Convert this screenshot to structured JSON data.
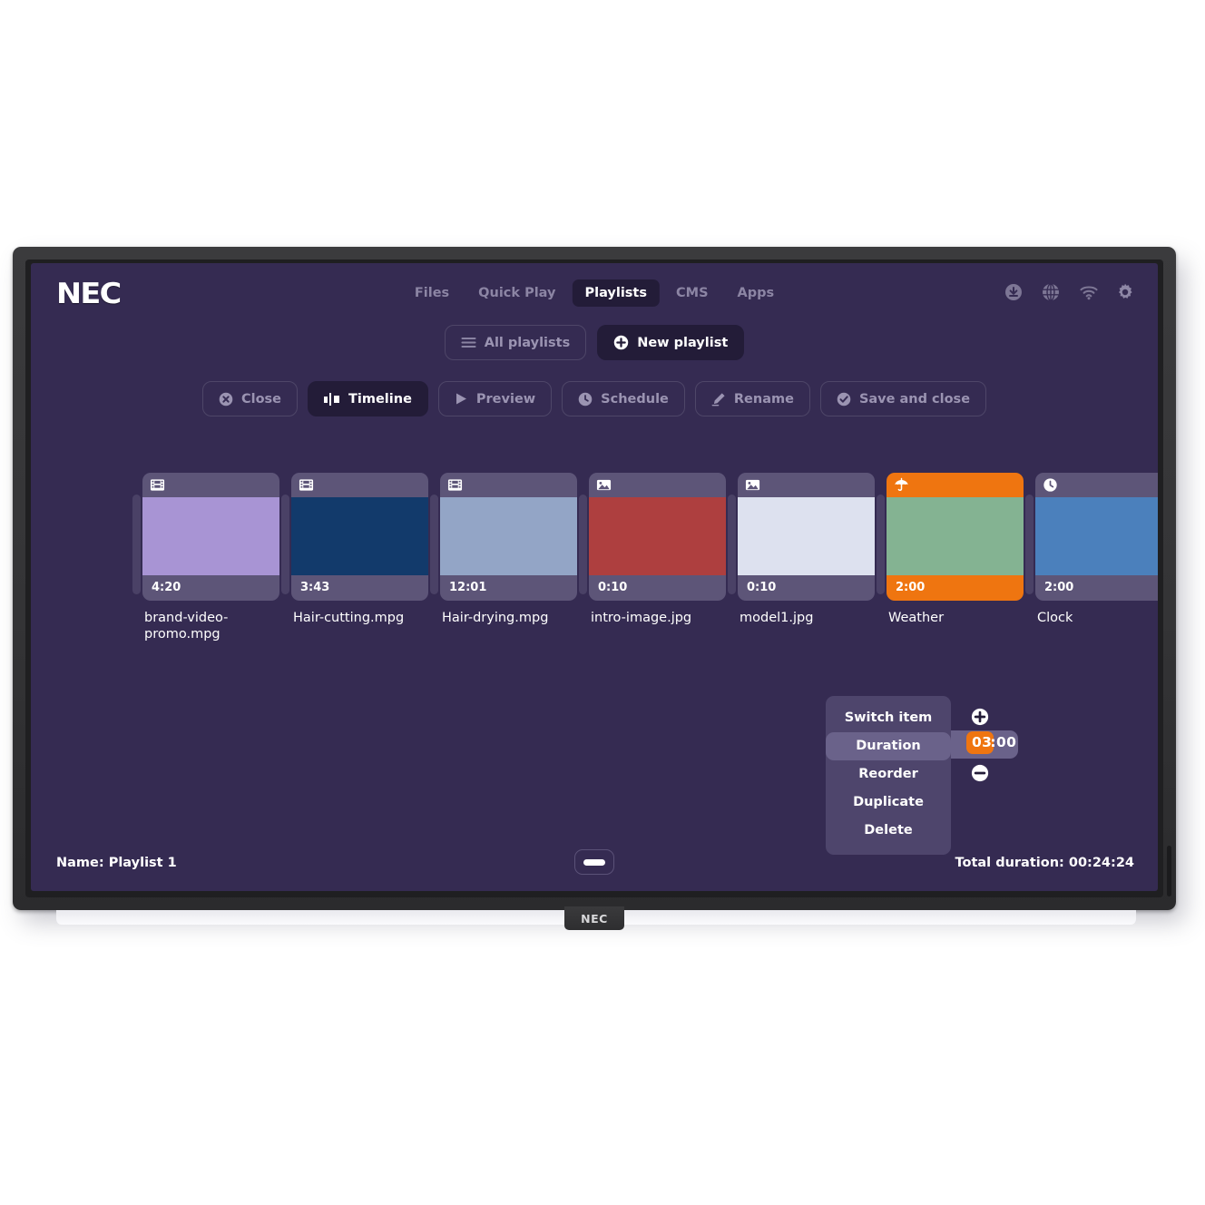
{
  "device": {
    "brand_logo": "NEC",
    "bezel_logo": "NEC"
  },
  "nav": {
    "items": [
      {
        "label": "Files",
        "active": false
      },
      {
        "label": "Quick Play",
        "active": false
      },
      {
        "label": "Playlists",
        "active": true
      },
      {
        "label": "CMS",
        "active": false
      },
      {
        "label": "Apps",
        "active": false
      }
    ]
  },
  "status_icons": [
    {
      "name": "download-icon"
    },
    {
      "name": "globe-icon"
    },
    {
      "name": "wifi-icon"
    },
    {
      "name": "gear-icon"
    }
  ],
  "subbar": {
    "all_playlists": {
      "label": "All playlists",
      "icon": "hamburger-icon",
      "style": "outline"
    },
    "new_playlist": {
      "label": "New playlist",
      "icon": "plus-circle-icon",
      "style": "solid"
    }
  },
  "toolbar": {
    "buttons": [
      {
        "label": "Close",
        "icon": "close-circle-icon",
        "active": false
      },
      {
        "label": "Timeline",
        "icon": "timeline-icon",
        "active": true
      },
      {
        "label": "Preview",
        "icon": "play-icon",
        "active": false
      },
      {
        "label": "Schedule",
        "icon": "clock-icon",
        "active": false
      },
      {
        "label": "Rename",
        "icon": "pencil-icon",
        "active": false
      },
      {
        "label": "Save and close",
        "icon": "check-circle-icon",
        "active": false
      }
    ]
  },
  "timeline": {
    "items": [
      {
        "label": "brand-video-promo.mpg",
        "duration": "4:20",
        "icon": "film-icon",
        "thumb_color": "#a894d4",
        "frame_color": "#5d5578",
        "selected": false
      },
      {
        "label": "Hair-cutting.mpg",
        "duration": "3:43",
        "icon": "film-icon",
        "thumb_color": "#123a6b",
        "frame_color": "#5d5578",
        "selected": false
      },
      {
        "label": "Hair-drying.mpg",
        "duration": "12:01",
        "icon": "film-icon",
        "thumb_color": "#93a5c6",
        "frame_color": "#5d5578",
        "selected": false
      },
      {
        "label": "intro-image.jpg",
        "duration": "0:10",
        "icon": "image-icon",
        "thumb_color": "#ae3f3f",
        "frame_color": "#5d5578",
        "selected": false
      },
      {
        "label": "model1.jpg",
        "duration": "0:10",
        "icon": "image-icon",
        "thumb_color": "#dde1ef",
        "frame_color": "#5d5578",
        "selected": false
      },
      {
        "label": "Weather",
        "duration": "2:00",
        "icon": "umbrella-icon",
        "thumb_color": "#84b392",
        "frame_color": "#ef7510",
        "selected": true
      },
      {
        "label": "Clock",
        "duration": "2:00",
        "icon": "clock-icon",
        "thumb_color": "#4b80bc",
        "frame_color": "#5d5578",
        "selected": false
      }
    ]
  },
  "context_menu": {
    "items": [
      {
        "label": "Switch item",
        "highlighted": false
      },
      {
        "label": "Duration",
        "highlighted": true
      },
      {
        "label": "Reorder",
        "highlighted": false
      },
      {
        "label": "Duplicate",
        "highlighted": false
      },
      {
        "label": "Delete",
        "highlighted": false
      }
    ],
    "duration_value_hot": "03",
    "duration_value_rest": ":00",
    "increment_icon": "plus-circle-icon",
    "decrement_icon": "minus-circle-icon",
    "accent_color": "#ef7510"
  },
  "footer": {
    "name_label": "Name: Playlist 1",
    "total_duration_label": "Total duration: 00:24:24",
    "collapse_icon": "collapse-handle-icon"
  }
}
